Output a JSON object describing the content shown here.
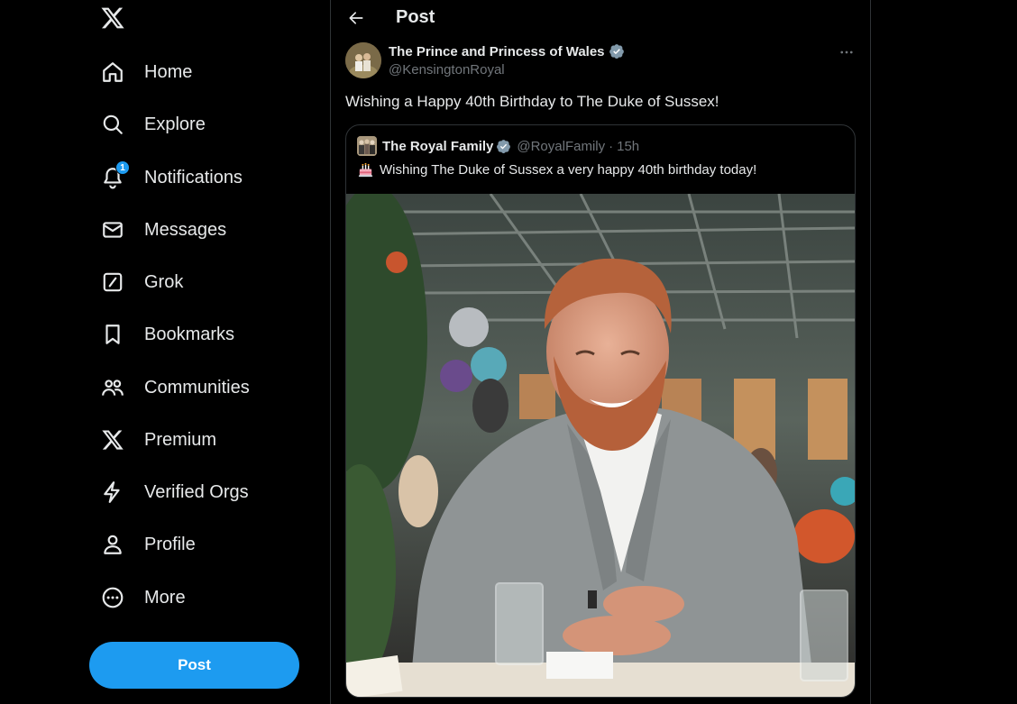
{
  "sidebar": {
    "logo_icon": "x-logo-icon",
    "items": [
      {
        "label": "Home",
        "icon": "home-icon"
      },
      {
        "label": "Explore",
        "icon": "search-icon"
      },
      {
        "label": "Notifications",
        "icon": "bell-icon",
        "badge": "1"
      },
      {
        "label": "Messages",
        "icon": "envelope-icon"
      },
      {
        "label": "Grok",
        "icon": "grok-icon"
      },
      {
        "label": "Bookmarks",
        "icon": "bookmark-icon"
      },
      {
        "label": "Communities",
        "icon": "people-icon"
      },
      {
        "label": "Premium",
        "icon": "x-logo-icon"
      },
      {
        "label": "Verified Orgs",
        "icon": "lightning-icon"
      },
      {
        "label": "Profile",
        "icon": "person-icon"
      },
      {
        "label": "More",
        "icon": "more-circle-icon"
      }
    ],
    "post_button": "Post"
  },
  "header": {
    "title": "Post"
  },
  "tweet": {
    "author_name": "The Prince and Princess of Wales",
    "author_handle": "@KensingtonRoyal",
    "text": "Wishing a Happy 40th Birthday to The Duke of Sussex!",
    "quoted": {
      "author_name": "The Royal Family",
      "author_handle": "@RoyalFamily",
      "separator": "·",
      "time": "15h",
      "text": "Wishing The Duke of Sussex a very happy 40th birthday today!",
      "emoji": "birthday-cake-icon"
    }
  },
  "colors": {
    "accent": "#1d9bf0",
    "background": "#000000",
    "text_primary": "#e7e9ea",
    "text_secondary": "#71767b",
    "border": "#2f3336",
    "verified": "#829aab"
  }
}
